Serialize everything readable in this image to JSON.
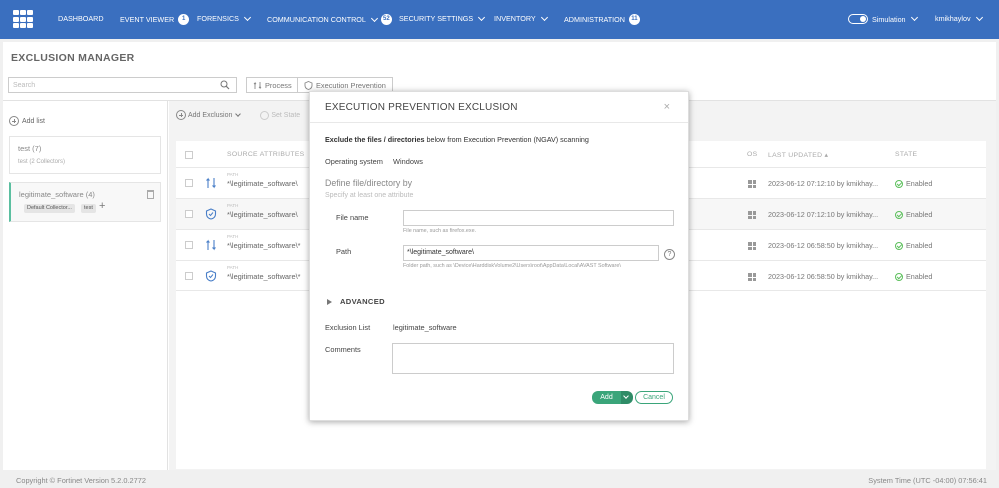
{
  "nav": {
    "items": [
      {
        "label": "DASHBOARD",
        "badge": null,
        "chevron": false
      },
      {
        "label": "EVENT VIEWER",
        "badge": "1",
        "chevron": false
      },
      {
        "label": "FORENSICS",
        "badge": null,
        "chevron": true
      },
      {
        "label": "COMMUNICATION CONTROL",
        "badge": "52",
        "chevron": true
      },
      {
        "label": "SECURITY SETTINGS",
        "badge": null,
        "chevron": true
      },
      {
        "label": "INVENTORY",
        "badge": null,
        "chevron": true
      },
      {
        "label": "ADMINISTRATION",
        "badge": "11",
        "chevron": false
      }
    ],
    "simulation_label": "Simulation",
    "user": "kmikhaylov"
  },
  "page": {
    "title": "EXCLUSION MANAGER",
    "search_placeholder": "Search",
    "tab_process": "Process",
    "tab_execution_prevention": "Execution Prevention",
    "add_list": "Add list",
    "lists": [
      {
        "name": "test (7)",
        "sub": "test (2 Collectors)"
      },
      {
        "name": "legitimate_software (4)",
        "tags": [
          "Default Collector...",
          "test"
        ]
      }
    ],
    "add_exclusion": "Add Exclusion",
    "set_state": "Set State"
  },
  "table": {
    "headers": {
      "source": "SOURCE ATTRIBUTES",
      "os": "OS",
      "updated": "LAST UPDATED",
      "state": "STATE"
    },
    "rows": [
      {
        "small": "PATH",
        "attribute": "*\\legitimate_software\\",
        "icon": "process-icon",
        "updated": "2023-06-12 07:12:10 by kmikhay...",
        "state": "Enabled"
      },
      {
        "small": "PATH",
        "attribute": "*\\legitimate_software\\",
        "icon": "shield-icon",
        "updated": "2023-06-12 07:12:10 by kmikhay...",
        "state": "Enabled"
      },
      {
        "small": "PATH",
        "attribute": "*\\legitimate_software\\*",
        "icon": "process-icon",
        "updated": "2023-06-12 06:58:50 by kmikhay...",
        "state": "Enabled"
      },
      {
        "small": "PATH",
        "attribute": "*\\legitimate_software\\*",
        "icon": "shield-icon",
        "updated": "2023-06-12 06:58:50 by kmikhay...",
        "state": "Enabled"
      }
    ]
  },
  "modal": {
    "title": "EXECUTION PREVENTION EXCLUSION",
    "close": "×",
    "desc_bold": "Exclude the files / directories",
    "desc_rest": " below from Execution Prevention (NGAV) scanning",
    "os_label": "Operating system",
    "os_value": "Windows",
    "define_title": "Define file/directory by",
    "define_sub": "Specify at least one attribute",
    "file_name_label": "File name",
    "file_name_value": "",
    "file_name_hint": "File name, such as firefox.exe.",
    "path_label": "Path",
    "path_value": "*\\legitimate_software\\",
    "path_hint": "Folder path, such as \\Device\\HarddiskVolume2\\Users\\root\\AppData\\Local\\AVAST Software\\",
    "help": "?",
    "advanced": "ADVANCED",
    "exclusion_list_label": "Exclusion List",
    "exclusion_list_value": "legitimate_software",
    "comments_label": "Comments",
    "add_button": "Add",
    "cancel_button": "Cancel"
  },
  "footer": {
    "copyright": "Copyright © Fortinet Version 5.2.0.2772",
    "system_time": "System Time (UTC -04:00) 07:56:41"
  },
  "colors": {
    "nav_bg": "#3a6fbf",
    "accent_green": "#3aa57a",
    "enabled_green": "#5bbf5b"
  }
}
